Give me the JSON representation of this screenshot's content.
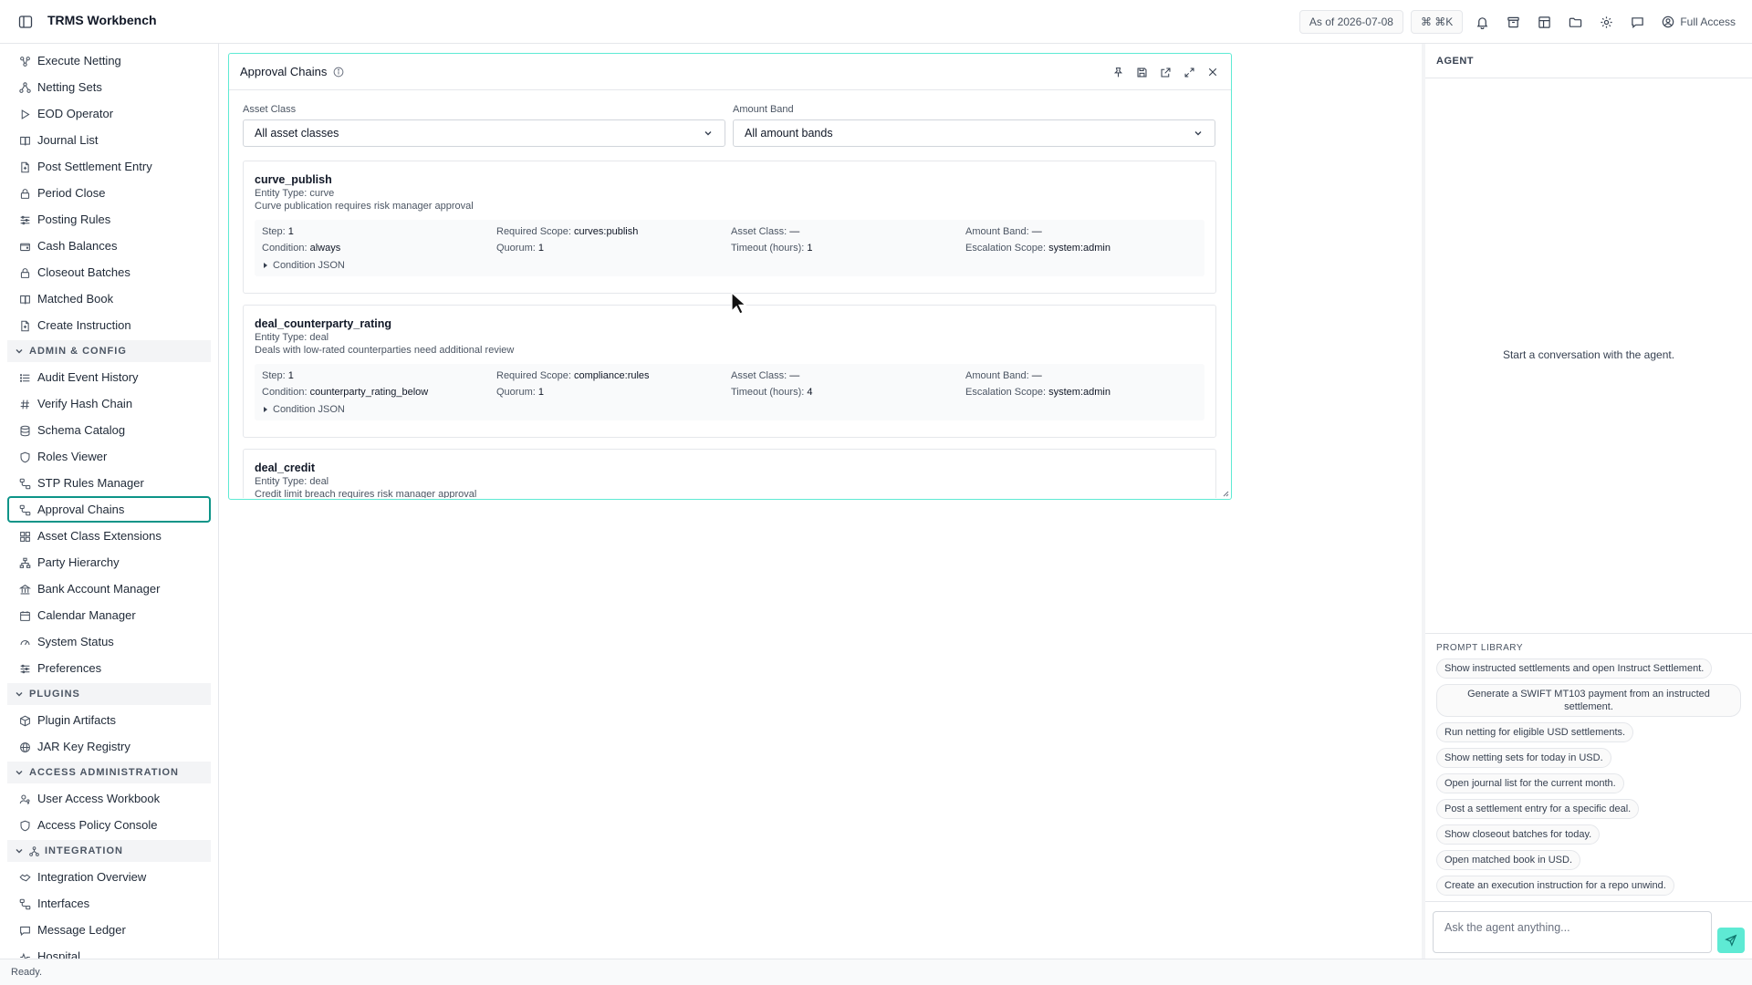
{
  "app": {
    "title": "TRMS Workbench"
  },
  "topbar": {
    "as_of": "As of 2026-07-08",
    "shortcut": "⌘ ⌘K",
    "access": "Full Access"
  },
  "sidebar": {
    "items_top": [
      {
        "label": "Execute Netting",
        "icon": "netting-icon"
      },
      {
        "label": "Netting Sets",
        "icon": "network-icon"
      },
      {
        "label": "EOD Operator",
        "icon": "play-icon"
      },
      {
        "label": "Journal List",
        "icon": "book-icon"
      },
      {
        "label": "Post Settlement Entry",
        "icon": "file-icon"
      },
      {
        "label": "Period Close",
        "icon": "lock-icon"
      },
      {
        "label": "Posting Rules",
        "icon": "sliders-icon"
      },
      {
        "label": "Cash Balances",
        "icon": "wallet-icon"
      },
      {
        "label": "Closeout Batches",
        "icon": "lock-icon"
      },
      {
        "label": "Matched Book",
        "icon": "book-icon"
      },
      {
        "label": "Create Instruction",
        "icon": "file-icon"
      }
    ],
    "section_admin": "ADMIN & CONFIG",
    "items_admin": [
      {
        "label": "Audit Event History",
        "icon": "list-icon"
      },
      {
        "label": "Verify Hash Chain",
        "icon": "hash-icon"
      },
      {
        "label": "Schema Catalog",
        "icon": "database-icon"
      },
      {
        "label": "Roles Viewer",
        "icon": "shield-icon"
      },
      {
        "label": "STP Rules Manager",
        "icon": "workflow-icon"
      },
      {
        "label": "Approval Chains",
        "icon": "workflow-icon"
      },
      {
        "label": "Asset Class Extensions",
        "icon": "grid-icon"
      },
      {
        "label": "Party Hierarchy",
        "icon": "hierarchy-icon"
      },
      {
        "label": "Bank Account Manager",
        "icon": "bank-icon"
      },
      {
        "label": "Calendar Manager",
        "icon": "calendar-icon"
      },
      {
        "label": "System Status",
        "icon": "gauge-icon"
      },
      {
        "label": "Preferences",
        "icon": "sliders-icon"
      }
    ],
    "section_plugins": "PLUGINS",
    "items_plugins": [
      {
        "label": "Plugin Artifacts",
        "icon": "package-icon"
      },
      {
        "label": "JAR Key Registry",
        "icon": "globe-icon"
      }
    ],
    "section_access": "ACCESS ADMINISTRATION",
    "items_access": [
      {
        "label": "User Access Workbook",
        "icon": "user-key-icon"
      },
      {
        "label": "Access Policy Console",
        "icon": "shield-icon"
      }
    ],
    "section_integration": "INTEGRATION",
    "items_integration": [
      {
        "label": "Integration Overview",
        "icon": "handshake-icon"
      },
      {
        "label": "Interfaces",
        "icon": "workflow-icon"
      },
      {
        "label": "Message Ledger",
        "icon": "message-icon"
      },
      {
        "label": "Hospital",
        "icon": "pulse-icon"
      }
    ]
  },
  "panel": {
    "title": "Approval Chains",
    "filters": {
      "asset_class_label": "Asset Class",
      "asset_class_value": "All asset classes",
      "amount_band_label": "Amount Band",
      "amount_band_value": "All amount bands"
    },
    "labels": {
      "step": "Step:",
      "condition": "Condition:",
      "required_scope": "Required Scope:",
      "quorum": "Quorum:",
      "asset_class": "Asset Class:",
      "timeout": "Timeout (hours):",
      "amount_band": "Amount Band:",
      "escalation_scope": "Escalation Scope:",
      "condition_json": "Condition JSON"
    },
    "chains": [
      {
        "name": "curve_publish",
        "entity_type": "Entity Type: curve",
        "description": "Curve publication requires risk manager approval",
        "step": "1",
        "condition": "always",
        "required_scope": "curves:publish",
        "quorum": "1",
        "asset_class": "—",
        "timeout": "1",
        "amount_band": "—",
        "escalation_scope": "system:admin"
      },
      {
        "name": "deal_counterparty_rating",
        "entity_type": "Entity Type: deal",
        "description": "Deals with low-rated counterparties need additional review",
        "step": "1",
        "condition": "counterparty_rating_below",
        "required_scope": "compliance:rules",
        "quorum": "1",
        "asset_class": "—",
        "timeout": "4",
        "amount_band": "—",
        "escalation_scope": "system:admin"
      },
      {
        "name": "deal_credit",
        "entity_type": "Entity Type: deal",
        "description": "Credit limit breach requires risk manager approval"
      }
    ]
  },
  "agent": {
    "header": "AGENT",
    "empty_state": "Start a conversation with the agent.",
    "prompt_library_title": "PROMPT LIBRARY",
    "prompts": [
      "Show instructed settlements and open Instruct Settlement.",
      "Generate a SWIFT MT103 payment from an instructed settlement.",
      "Run netting for eligible USD settlements.",
      "Show netting sets for today in USD.",
      "Open journal list for the current month.",
      "Post a settlement entry for a specific deal.",
      "Show closeout batches for today.",
      "Open matched book in USD.",
      "Create an execution instruction for a repo unwind."
    ],
    "input_placeholder": "Ask the agent anything..."
  },
  "status": {
    "text": "Ready."
  },
  "colors": {
    "accent": "#0d9488",
    "accent_light": "#5eead4"
  }
}
